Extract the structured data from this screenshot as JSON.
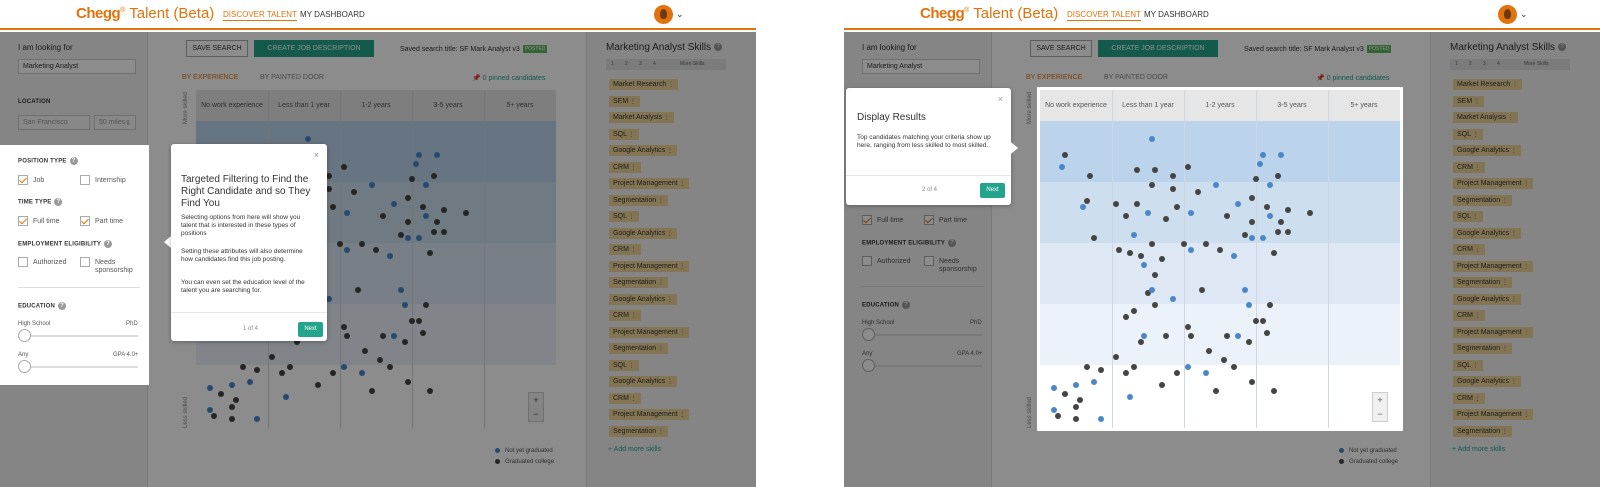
{
  "header": {
    "logo_brand": "Chegg",
    "logo_tm": "®",
    "logo_product": " Talent (Beta)",
    "nav_discover": "DISCOVER TALENT",
    "nav_dashboard": "MY DASHBOARD"
  },
  "sidebar": {
    "looking_for_label": "I am looking for",
    "looking_for_value": "Marketing Analyst",
    "location_label": "LOCATION",
    "location_value": "San Francisco",
    "radius_value": "50 miles",
    "position_type_label": "POSITION TYPE",
    "job_label": "Job",
    "internship_label": "Internship",
    "time_type_label": "TIME TYPE",
    "full_time_label": "Full time",
    "part_time_label": "Part time",
    "eligibility_label": "EMPLOYMENT ELIGIBILITY",
    "authorized_label": "Authorized",
    "needs_sponsorship_label": "Needs sponsorship",
    "education_label": "EDUCATION",
    "edu_min": "High School",
    "edu_max": "PhD",
    "gpa_min": "Any",
    "gpa_max": "GPA 4.0+"
  },
  "toolbar": {
    "save_search": "SAVE SEARCH",
    "create_job": "CREATE JOB DESCRIPTION",
    "saved_title": "Saved search title: SF Mark Analyst v3",
    "posted_badge": "POSTED",
    "tab_experience": "BY EXPERIENCE",
    "tab_painted_door": "BY PAINTED DOOR",
    "pinned": "0 pinned candidates"
  },
  "chart_data": {
    "type": "scatter",
    "categories": [
      "No work experience",
      "Less than 1 year",
      "1-2 years",
      "3-5 years",
      "5+ years"
    ],
    "y_axis_top": "More skilled",
    "y_axis_bottom": "Less skilled",
    "legend": [
      {
        "name": "Not yet graduated",
        "color": "#4a86c8"
      },
      {
        "name": "Graduated college",
        "color": "#444444"
      }
    ],
    "points": [
      {
        "x": 0.35,
        "y": 0.89,
        "s": "g"
      },
      {
        "x": 0.3,
        "y": 0.85,
        "s": "b"
      },
      {
        "x": 0.7,
        "y": 0.82,
        "s": "g"
      },
      {
        "x": 0.65,
        "y": 0.74,
        "s": "g"
      },
      {
        "x": 0.6,
        "y": 0.72,
        "s": "b"
      },
      {
        "x": 1.05,
        "y": 0.73,
        "s": "g"
      },
      {
        "x": 1.55,
        "y": 0.94,
        "s": "b"
      },
      {
        "x": 0.75,
        "y": 0.62,
        "s": "g"
      },
      {
        "x": 1.2,
        "y": 0.69,
        "s": "g"
      },
      {
        "x": 1.5,
        "y": 0.7,
        "s": "b"
      },
      {
        "x": 1.35,
        "y": 0.73,
        "s": "g"
      },
      {
        "x": 1.75,
        "y": 0.68,
        "s": "g"
      },
      {
        "x": 1.3,
        "y": 0.63,
        "s": "b"
      },
      {
        "x": 1.45,
        "y": 0.53,
        "s": "b"
      },
      {
        "x": 1.5,
        "y": 0.44,
        "s": "g"
      },
      {
        "x": 1.9,
        "y": 0.72,
        "s": "g"
      },
      {
        "x": 2.1,
        "y": 0.7,
        "s": "b"
      },
      {
        "x": 2.5,
        "y": 0.58,
        "s": "g"
      },
      {
        "x": 2.3,
        "y": 0.6,
        "s": "g"
      },
      {
        "x": 2.0,
        "y": 0.6,
        "s": "g"
      },
      {
        "x": 1.7,
        "y": 0.55,
        "s": "g"
      },
      {
        "x": 1.55,
        "y": 0.6,
        "s": "g"
      },
      {
        "x": 1.4,
        "y": 0.56,
        "s": "g"
      },
      {
        "x": 1.25,
        "y": 0.57,
        "s": "g"
      },
      {
        "x": 1.1,
        "y": 0.58,
        "s": "g"
      },
      {
        "x": 1.6,
        "y": 0.5,
        "s": "g"
      },
      {
        "x": 1.35,
        "y": 0.84,
        "s": "g"
      },
      {
        "x": 1.6,
        "y": 0.84,
        "s": "g"
      },
      {
        "x": 1.85,
        "y": 0.82,
        "s": "g"
      },
      {
        "x": 2.05,
        "y": 0.85,
        "s": "g"
      },
      {
        "x": 1.55,
        "y": 0.79,
        "s": "g"
      },
      {
        "x": 1.85,
        "y": 0.78,
        "s": "g"
      },
      {
        "x": 2.2,
        "y": 0.77,
        "s": "g"
      },
      {
        "x": 2.75,
        "y": 0.73,
        "s": "b"
      },
      {
        "x": 2.45,
        "y": 0.79,
        "s": "b"
      },
      {
        "x": 2.6,
        "y": 0.69,
        "s": "g"
      },
      {
        "x": 2.95,
        "y": 0.75,
        "s": "g"
      },
      {
        "x": 3.1,
        "y": 0.89,
        "s": "b"
      },
      {
        "x": 3.35,
        "y": 0.89,
        "s": "b"
      },
      {
        "x": 3.05,
        "y": 0.86,
        "s": "b"
      },
      {
        "x": 3.3,
        "y": 0.82,
        "s": "g"
      },
      {
        "x": 3.0,
        "y": 0.81,
        "s": "g"
      },
      {
        "x": 3.2,
        "y": 0.79,
        "s": "b"
      },
      {
        "x": 3.15,
        "y": 0.72,
        "s": "g"
      },
      {
        "x": 3.45,
        "y": 0.71,
        "s": "g"
      },
      {
        "x": 3.75,
        "y": 0.7,
        "s": "g"
      },
      {
        "x": 3.2,
        "y": 0.69,
        "s": "b"
      },
      {
        "x": 3.1,
        "y": 0.62,
        "s": "b"
      },
      {
        "x": 3.3,
        "y": 0.64,
        "s": "g"
      },
      {
        "x": 3.35,
        "y": 0.67,
        "s": "g"
      },
      {
        "x": 3.45,
        "y": 0.64,
        "s": "g"
      },
      {
        "x": 2.85,
        "y": 0.63,
        "s": "g"
      },
      {
        "x": 3.25,
        "y": 0.57,
        "s": "g"
      },
      {
        "x": 2.95,
        "y": 0.62,
        "s": "b"
      },
      {
        "x": 2.7,
        "y": 0.56,
        "s": "b"
      },
      {
        "x": 2.1,
        "y": 0.58,
        "s": "b"
      },
      {
        "x": 2.95,
        "y": 0.67,
        "s": "g"
      },
      {
        "x": 2.85,
        "y": 0.45,
        "s": "b"
      },
      {
        "x": 2.9,
        "y": 0.4,
        "s": "b"
      },
      {
        "x": 3.0,
        "y": 0.35,
        "s": "g"
      },
      {
        "x": 3.2,
        "y": 0.4,
        "s": "g"
      },
      {
        "x": 3.1,
        "y": 0.35,
        "s": "g"
      },
      {
        "x": 3.15,
        "y": 0.31,
        "s": "g"
      },
      {
        "x": 2.75,
        "y": 0.3,
        "s": "b"
      },
      {
        "x": 2.6,
        "y": 0.3,
        "s": "g"
      },
      {
        "x": 2.9,
        "y": 0.28,
        "s": "g"
      },
      {
        "x": 2.35,
        "y": 0.25,
        "s": "g"
      },
      {
        "x": 2.55,
        "y": 0.22,
        "s": "g"
      },
      {
        "x": 2.7,
        "y": 0.2,
        "s": "g"
      },
      {
        "x": 2.3,
        "y": 0.18,
        "s": "b"
      },
      {
        "x": 2.95,
        "y": 0.15,
        "s": "g"
      },
      {
        "x": 3.25,
        "y": 0.12,
        "s": "g"
      },
      {
        "x": 2.45,
        "y": 0.12,
        "s": "g"
      },
      {
        "x": 2.05,
        "y": 0.2,
        "s": "b"
      },
      {
        "x": 1.9,
        "y": 0.18,
        "s": "g"
      },
      {
        "x": 1.7,
        "y": 0.14,
        "s": "g"
      },
      {
        "x": 1.4,
        "y": 0.28,
        "s": "g"
      },
      {
        "x": 1.45,
        "y": 0.3,
        "s": "b"
      },
      {
        "x": 1.75,
        "y": 0.3,
        "s": "g"
      },
      {
        "x": 2.1,
        "y": 0.3,
        "s": "g"
      },
      {
        "x": 2.05,
        "y": 0.33,
        "s": "g"
      },
      {
        "x": 1.6,
        "y": 0.4,
        "s": "g"
      },
      {
        "x": 2.25,
        "y": 0.45,
        "s": "g"
      },
      {
        "x": 1.55,
        "y": 0.45,
        "s": "b"
      },
      {
        "x": 1.85,
        "y": 0.42,
        "s": "b"
      },
      {
        "x": 1.3,
        "y": 0.38,
        "s": "g"
      },
      {
        "x": 1.2,
        "y": 0.36,
        "s": "g"
      },
      {
        "x": 1.05,
        "y": 0.23,
        "s": "g"
      },
      {
        "x": 0.85,
        "y": 0.19,
        "s": "g"
      },
      {
        "x": 1.3,
        "y": 0.2,
        "s": "g"
      },
      {
        "x": 0.75,
        "y": 0.15,
        "s": "b"
      },
      {
        "x": 0.65,
        "y": 0.2,
        "s": "g"
      },
      {
        "x": 1.2,
        "y": 0.18,
        "s": "g"
      },
      {
        "x": 0.5,
        "y": 0.14,
        "s": "b"
      },
      {
        "x": 0.2,
        "y": 0.13,
        "s": "b"
      },
      {
        "x": 0.35,
        "y": 0.11,
        "s": "g"
      },
      {
        "x": 1.25,
        "y": 0.1,
        "s": "b"
      },
      {
        "x": 0.55,
        "y": 0.09,
        "s": "g"
      },
      {
        "x": 0.5,
        "y": 0.07,
        "s": "g"
      },
      {
        "x": 0.2,
        "y": 0.06,
        "s": "b"
      },
      {
        "x": 0.25,
        "y": 0.04,
        "s": "g"
      },
      {
        "x": 0.5,
        "y": 0.03,
        "s": "g"
      },
      {
        "x": 0.85,
        "y": 0.03,
        "s": "b"
      }
    ]
  },
  "zoom": {
    "plus": "+",
    "minus": "−"
  },
  "skills": {
    "title": "Marketing Analyst Skills",
    "pages": [
      "1",
      "2",
      "3",
      "4"
    ],
    "more": "More Skills",
    "items": [
      "Market Research",
      "SEM",
      "Market Analysis",
      "SQL",
      "Google Analytics",
      "CRM",
      "Project Management",
      "Segmentation",
      "SQL",
      "Google Analytics",
      "CRM",
      "Project Management",
      "Segmentation",
      "Google Analytics",
      "CRM",
      "Project Management",
      "Segmentation",
      "SQL",
      "Google Analytics",
      "CRM",
      "Project Management",
      "Segmentation"
    ],
    "add_more": "+ Add more skills"
  },
  "popup1": {
    "title": "Targeted Filtering to Find the Right Candidate and so They Find You",
    "p1": "Selecting options from here will show you talent that is interested in these types of positions",
    "p2": "Setting these attributes will also determine how candidates find this job posting.",
    "p3": "You can even set the education level of the talent you are searching for.",
    "count": "1 of 4",
    "next": "Next",
    "close": "×"
  },
  "popup2": {
    "title": "Display Results",
    "p1": "Top candidates matching your criteria show up here, ranging from less skilled to most skilled.",
    "count": "2 of 4",
    "next": "Next",
    "close": "×"
  }
}
